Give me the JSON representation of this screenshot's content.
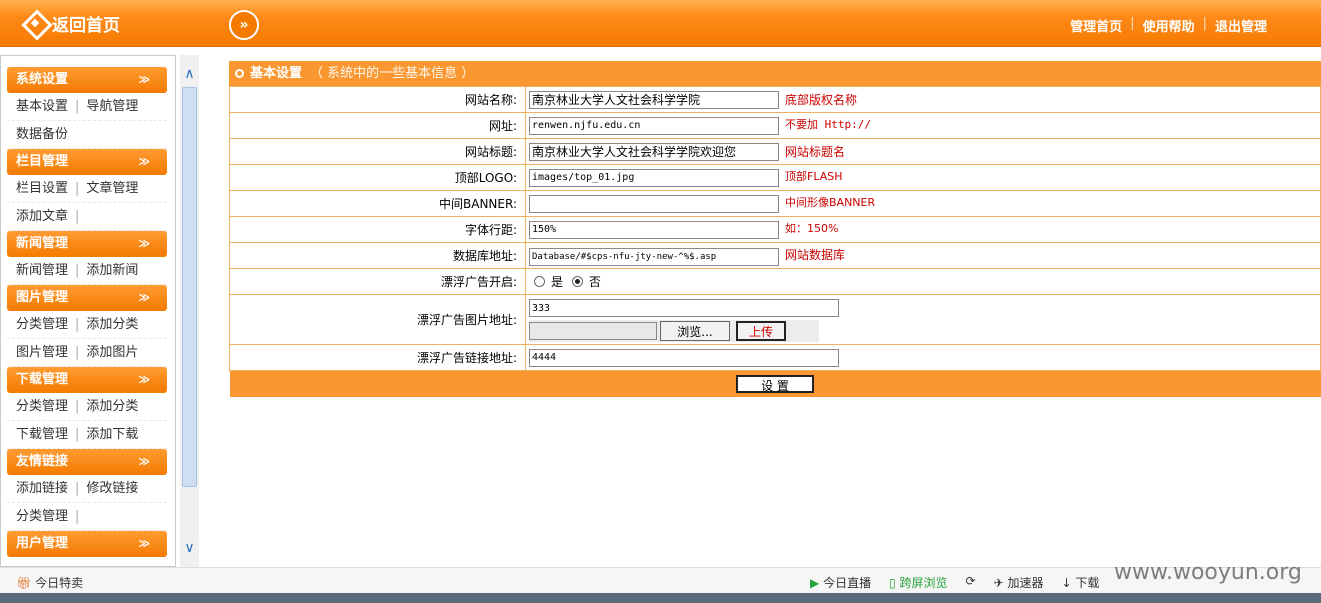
{
  "topbar": {
    "logo_text": "返回首页",
    "toggle_symbol": "»",
    "nav": [
      "管理首页",
      "使用帮助",
      "退出管理"
    ],
    "nav_sep": "|"
  },
  "sidebar": {
    "chevron": "≫",
    "sep": "|",
    "categories": [
      {
        "title": "系统设置",
        "rows": [
          [
            "基本设置",
            "导航管理"
          ],
          [
            "数据备份"
          ]
        ]
      },
      {
        "title": "栏目管理",
        "rows": [
          [
            "栏目设置",
            "文章管理"
          ],
          [
            "添加文章",
            ""
          ]
        ]
      },
      {
        "title": "新闻管理",
        "rows": [
          [
            "新闻管理",
            "添加新闻"
          ]
        ]
      },
      {
        "title": "图片管理",
        "rows": [
          [
            "分类管理",
            "添加分类"
          ],
          [
            "图片管理",
            "添加图片"
          ]
        ]
      },
      {
        "title": "下载管理",
        "rows": [
          [
            "分类管理",
            "添加分类"
          ],
          [
            "下载管理",
            "添加下载"
          ]
        ]
      },
      {
        "title": "友情链接",
        "rows": [
          [
            "添加链接",
            "修改链接"
          ],
          [
            "分类管理",
            ""
          ]
        ]
      },
      {
        "title": "用户管理",
        "rows": []
      }
    ]
  },
  "scrollbar": {
    "up": "∧",
    "down": "∨"
  },
  "panel": {
    "title": "基本设置",
    "desc": "（ 系统中的一些基本信息 ）"
  },
  "form": {
    "site_name": {
      "label": "网站名称:",
      "value": "南京林业大学人文社会科学学院",
      "hint": "底部版权名称"
    },
    "url": {
      "label": "网址:",
      "value": "renwen.njfu.edu.cn",
      "hint": "不要加 Http://"
    },
    "site_title": {
      "label": "网站标题:",
      "value": "南京林业大学人文社会科学学院欢迎您",
      "hint": "网站标题名"
    },
    "top_logo": {
      "label": "顶部LOGO:",
      "value": "images/top_01.jpg",
      "hint": "顶部FLASH"
    },
    "mid_banner": {
      "label": "中间BANNER:",
      "value": "",
      "hint": "中间形像BANNER"
    },
    "line_height": {
      "label": "字体行距:",
      "value": "150%",
      "hint": "如：150%"
    },
    "db_path": {
      "label": "数据库地址:",
      "value": "Database/#$cps-nfu-jty-new-^%$.asp",
      "hint": "网站数据库"
    },
    "float_ad": {
      "label": "漂浮广告开启:",
      "yes": "是",
      "no": "否",
      "selected": "否"
    },
    "float_img": {
      "label": "漂浮广告图片地址:",
      "value": "333",
      "browse": "浏览...",
      "upload": "上传"
    },
    "float_link": {
      "label": "漂浮广告链接地址:",
      "value": "4444"
    },
    "submit": "设 置"
  },
  "statusbar": {
    "left": "今日特卖",
    "items": [
      "今日直播",
      "跨屏浏览",
      "加速器",
      "下载"
    ]
  },
  "watermark": "www.wooyun.org",
  "colors": {
    "orange": "#f57a00",
    "panel": "#fb9730",
    "hint": "#cc0000"
  }
}
